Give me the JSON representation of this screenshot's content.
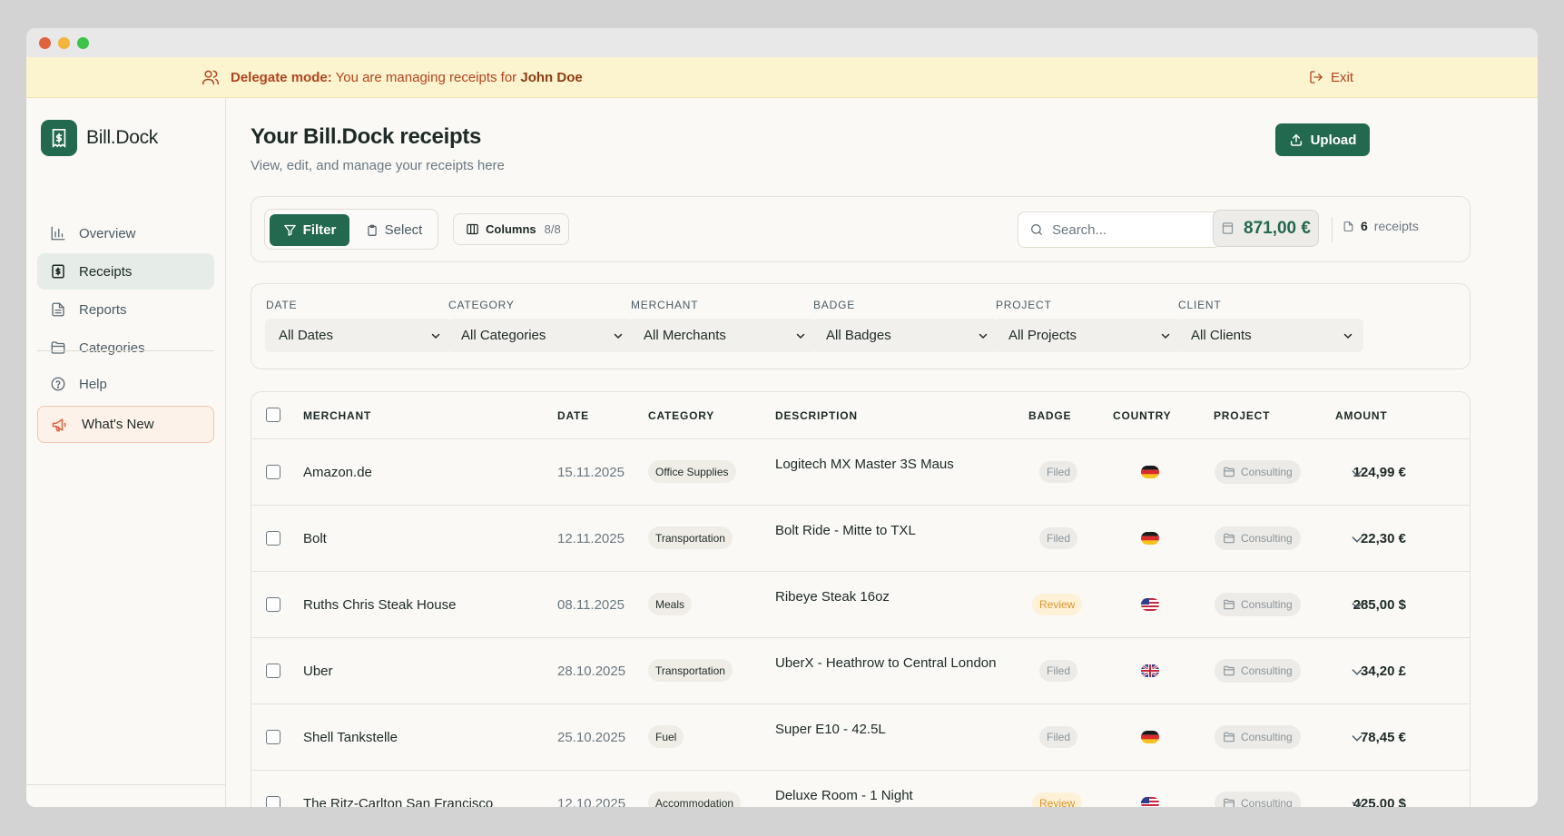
{
  "banner": {
    "prefix": "Delegate mode:",
    "text": "You are managing receipts for",
    "name": "John Doe",
    "exit_label": "Exit"
  },
  "sidebar": {
    "brand": "Bill.Dock",
    "items": [
      {
        "label": "Overview",
        "icon": "bar-chart-icon"
      },
      {
        "label": "Receipts",
        "icon": "receipt-icon"
      },
      {
        "label": "Reports",
        "icon": "document-icon"
      },
      {
        "label": "Categories",
        "icon": "folder-icon"
      }
    ],
    "help_label": "Help",
    "whats_new_label": "What's New"
  },
  "header": {
    "title": "Your Bill.Dock receipts",
    "subtitle": "View, edit, and manage your receipts here",
    "upload_label": "Upload"
  },
  "toolbar": {
    "filter_label": "Filter",
    "select_label": "Select",
    "columns_label": "Columns",
    "columns_count": "8/8",
    "search_placeholder": "Search...",
    "total": "871,00 €",
    "receipt_count": "6",
    "receipt_count_label": "receipts"
  },
  "filters": [
    {
      "label": "DATE",
      "value": "All Dates"
    },
    {
      "label": "CATEGORY",
      "value": "All Categories"
    },
    {
      "label": "MERCHANT",
      "value": "All Merchants"
    },
    {
      "label": "BADGE",
      "value": "All Badges"
    },
    {
      "label": "PROJECT",
      "value": "All Projects"
    },
    {
      "label": "CLIENT",
      "value": "All Clients"
    }
  ],
  "table": {
    "columns": [
      "MERCHANT",
      "DATE",
      "CATEGORY",
      "DESCRIPTION",
      "BADGE",
      "COUNTRY",
      "PROJECT",
      "AMOUNT"
    ],
    "rows": [
      {
        "merchant": "Amazon.de",
        "date": "15.11.2025",
        "category": "Office Supplies",
        "description": "Logitech MX Master 3S Maus",
        "badge": "Filed",
        "country": "DE",
        "project": "Consulting",
        "amount": "124,99 €"
      },
      {
        "merchant": "Bolt",
        "date": "12.11.2025",
        "category": "Transportation",
        "description": "Bolt Ride - Mitte to TXL",
        "badge": "Filed",
        "country": "DE",
        "project": "Consulting",
        "amount": "22,30 €"
      },
      {
        "merchant": "Ruths Chris Steak House",
        "date": "08.11.2025",
        "category": "Meals",
        "description": "Ribeye Steak 16oz",
        "badge": "Review",
        "country": "US",
        "project": "Consulting",
        "amount": "285,00 $"
      },
      {
        "merchant": "Uber",
        "date": "28.10.2025",
        "category": "Transportation",
        "description": "UberX - Heathrow to Central London",
        "badge": "Filed",
        "country": "GB",
        "project": "Consulting",
        "amount": "34,20 £"
      },
      {
        "merchant": "Shell Tankstelle",
        "date": "25.10.2025",
        "category": "Fuel",
        "description": "Super E10 - 42.5L",
        "badge": "Filed",
        "country": "DE",
        "project": "Consulting",
        "amount": "78,45 €"
      },
      {
        "merchant": "The Ritz-Carlton San Francisco",
        "date": "12.10.2025",
        "category": "Accommodation",
        "description": "Deluxe Room - 1 Night",
        "badge": "Review",
        "country": "US",
        "project": "Consulting",
        "amount": "425,00 $"
      }
    ]
  },
  "colors": {
    "brand": "#23694f",
    "banner_bg": "#fcf3cf",
    "banner_text": "#b0451d",
    "review_text": "#d9962b"
  }
}
